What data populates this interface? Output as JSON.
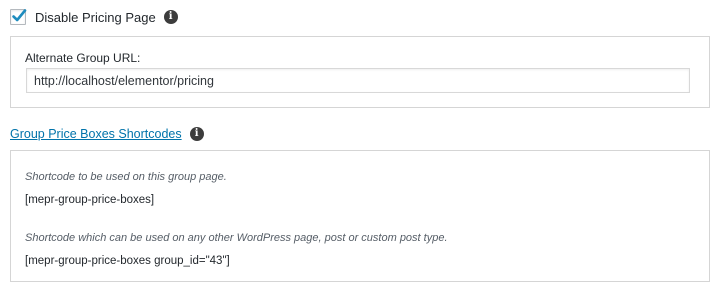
{
  "pricing": {
    "disable_checked": true,
    "disable_label": "Disable Pricing Page",
    "info_icon": "info-icon"
  },
  "alternate_url": {
    "label": "Alternate Group URL:",
    "value": "http://localhost/elementor/pricing"
  },
  "shortcodes": {
    "heading": "Group Price Boxes Shortcodes",
    "info_icon": "info-icon",
    "items": [
      {
        "description": "Shortcode to be used on this group page.",
        "code": "[mepr-group-price-boxes]"
      },
      {
        "description": "Shortcode which can be used on any other WordPress page, post or custom post type.",
        "code": "[mepr-group-price-boxes group_id=\"43\"]"
      }
    ]
  },
  "colors": {
    "link": "#0073aa",
    "checkmark": "#1e8cbe",
    "panel_border": "#d5d5d5"
  }
}
